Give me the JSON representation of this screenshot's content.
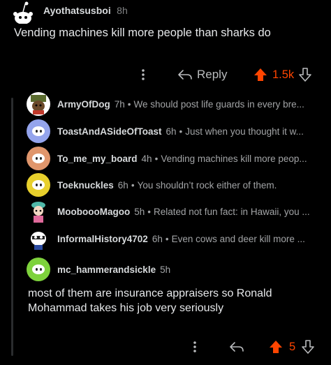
{
  "post": {
    "author": "Ayothatsusboi",
    "time": "8h",
    "body": "Vending machines kill more people than sharks do",
    "reply_label": "Reply",
    "score": "1.5k",
    "more_icon": "more-vertical-icon",
    "reply_icon": "reply-arrow-icon",
    "upvote_icon": "upvote-arrow-icon",
    "downvote_icon": "downvote-arrow-icon"
  },
  "replies": [
    {
      "author": "ArmyOfDog",
      "time": "7h",
      "sep": "•",
      "preview": "We should post life guards in every bre...",
      "avatar_color": "#ffffff"
    },
    {
      "author": "ToastAndASideOfToast",
      "time": "6h",
      "sep": "•",
      "preview": "Just when you thought it w...",
      "avatar_color": "#94a4ec"
    },
    {
      "author": "To_me_my_board",
      "time": "4h",
      "sep": "•",
      "preview": "Vending machines kill more peop...",
      "avatar_color": "#e0966c"
    },
    {
      "author": "Toeknuckles",
      "time": "6h",
      "sep": "•",
      "preview": "You shouldn’t rock either of them.",
      "avatar_color": "#e8d02c"
    },
    {
      "author": "MooboooMagoo",
      "time": "5h",
      "sep": "•",
      "preview": "Related not fun fact: in Hawaii, you ...",
      "avatar_color": "#000000"
    },
    {
      "author": "InformalHistory4702",
      "time": "6h",
      "sep": "•",
      "preview": "Even cows and deer kill more ...",
      "avatar_color": "#000000"
    }
  ],
  "last_reply": {
    "author": "mc_hammerandsickle",
    "time": "5h",
    "body": "most of them are insurance appraisers so Ronald Mohammad takes his job very seriously",
    "score": "5",
    "avatar_color": "#7ed23c"
  },
  "colors": {
    "background": "#000000",
    "accent_upvote": "#ff4500",
    "text_primary": "#d7dadc",
    "text_muted": "#818384"
  }
}
